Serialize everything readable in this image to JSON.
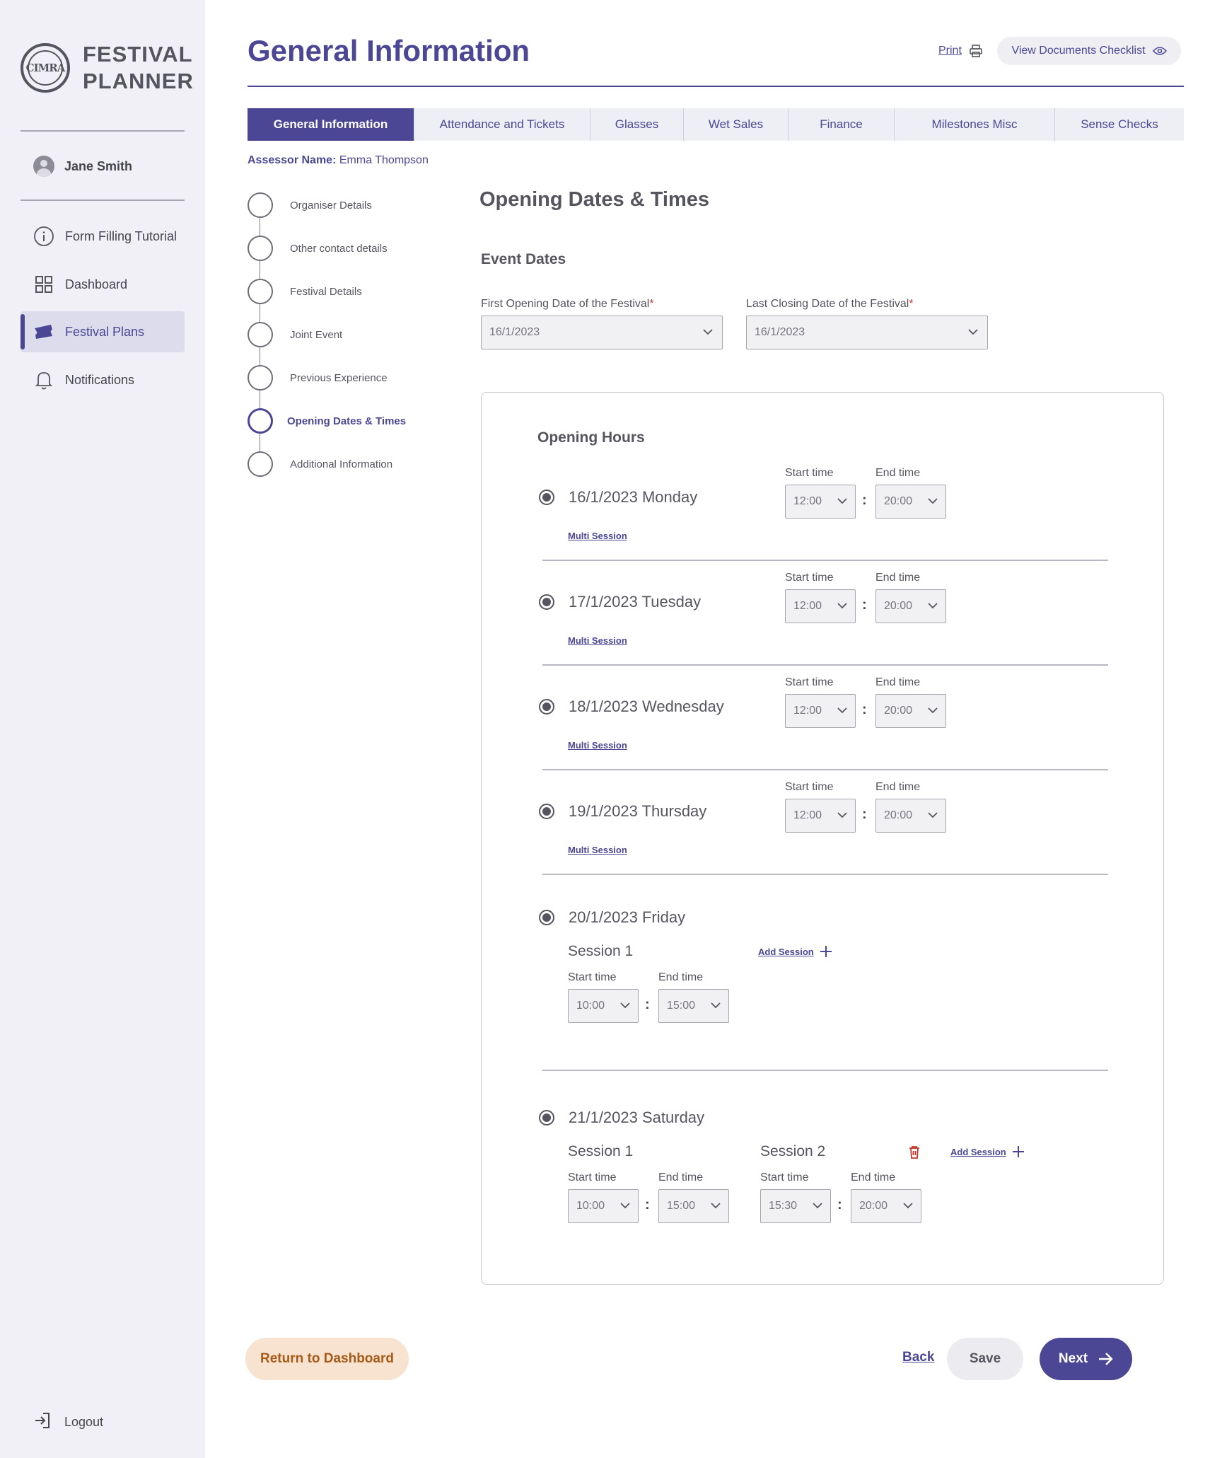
{
  "app": {
    "logo_mark": "CIMRA",
    "name_line1": "FESTIVAL",
    "name_line2": "PLANNER"
  },
  "user": {
    "name": "Jane Smith"
  },
  "sidebar": {
    "items": [
      {
        "label": "Form Filling Tutorial",
        "icon": "info-icon"
      },
      {
        "label": "Dashboard",
        "icon": "grid-icon"
      },
      {
        "label": "Festival Plans",
        "icon": "ticket-icon",
        "active": true
      },
      {
        "label": "Notifications",
        "icon": "bell-icon"
      }
    ],
    "logout": "Logout"
  },
  "header": {
    "title": "General Information",
    "print": "Print",
    "docs_checklist": "View Documents Checklist"
  },
  "tabs": [
    "General Information",
    "Attendance and Tickets",
    "Glasses",
    "Wet Sales",
    "Finance",
    "Milestones Misc",
    "Sense Checks"
  ],
  "assessor": {
    "label": "Assessor Name:",
    "name": "Emma Thompson"
  },
  "steps": [
    "Organiser Details",
    "Other contact details",
    "Festival Details",
    "Joint Event",
    "Previous Experience",
    "Opening Dates & Times",
    "Additional Information"
  ],
  "section": {
    "title": "Opening Dates & Times",
    "event_dates": "Event Dates"
  },
  "event_dates": {
    "first_label": "First Opening Date of the Festival",
    "first_value": "16/1/2023",
    "last_label": "Last Closing Date of the Festival",
    "last_value": "16/1/2023",
    "required_mark": "*"
  },
  "opening_hours": {
    "title": "Opening Hours",
    "start_label": "Start time",
    "end_label": "End time",
    "multi_session": "Multi  Session",
    "add_session": "Add  Session",
    "separator": ":",
    "days": [
      {
        "label": "16/1/2023 Monday",
        "start": "12:00",
        "end": "20:00"
      },
      {
        "label": "17/1/2023 Tuesday",
        "start": "12:00",
        "end": "20:00"
      },
      {
        "label": "18/1/2023 Wednesday",
        "start": "12:00",
        "end": "20:00"
      },
      {
        "label": "19/1/2023 Thursday",
        "start": "12:00",
        "end": "20:00"
      },
      {
        "label": "20/1/2023 Friday",
        "sessions": [
          {
            "label": "Session 1",
            "start": "10:00",
            "end": "15:00"
          }
        ]
      },
      {
        "label": "21/1/2023 Saturday",
        "sessions": [
          {
            "label": "Session 1",
            "start": "10:00",
            "end": "15:00"
          },
          {
            "label": "Session 2",
            "start": "15:30",
            "end": "20:00"
          }
        ]
      }
    ]
  },
  "footer": {
    "return": "Return to Dashboard",
    "back": "Back",
    "save": "Save",
    "next": "Next"
  },
  "colors": {
    "accent": "#4b4794",
    "sidebar_bg": "#f0f0f6",
    "return_bg": "#f8e2d0",
    "return_text": "#a65a18",
    "danger": "#c0392b"
  }
}
